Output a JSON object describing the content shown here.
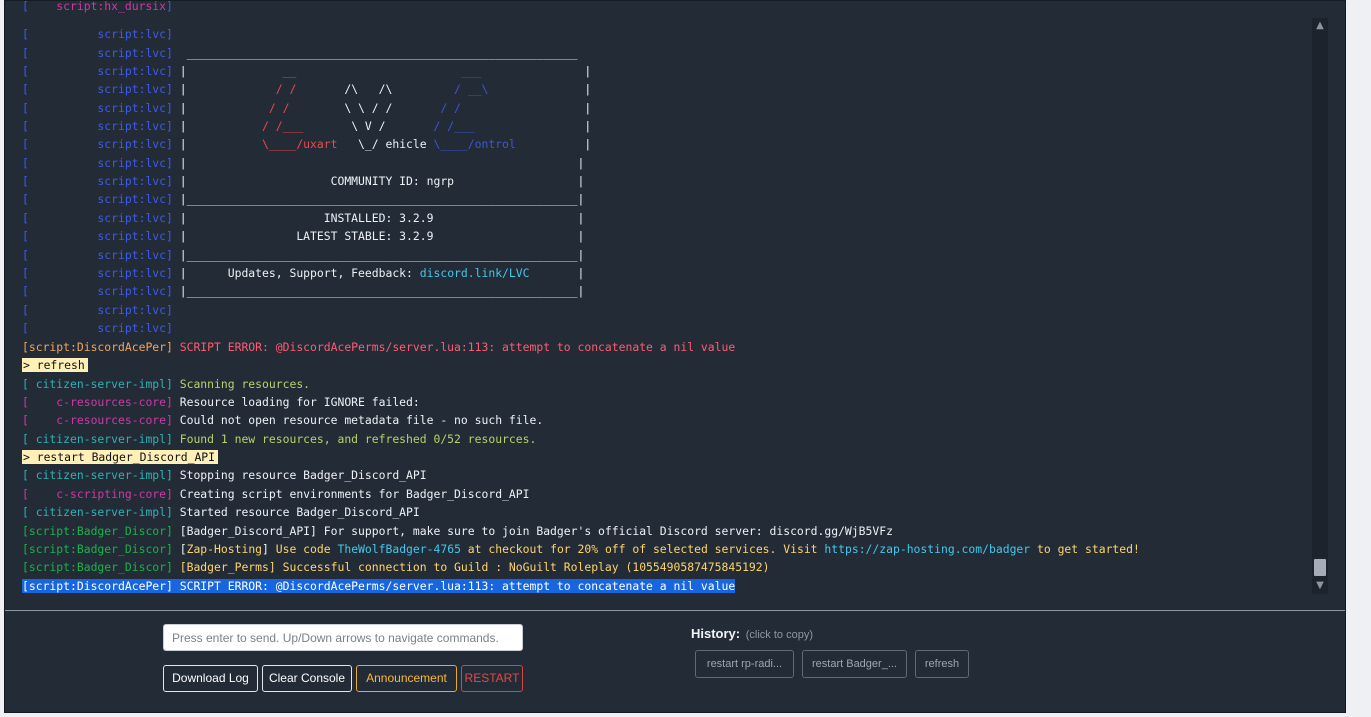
{
  "console": {
    "lines": [
      {
        "t": -4,
        "parts": [
          {
            "c": "c-blue",
            "v": "[    "
          },
          {
            "c": "c-res",
            "v": "script:hx_dursix"
          },
          {
            "c": "c-blue",
            "v": "]"
          }
        ]
      },
      {
        "t": 24,
        "parts": [
          {
            "c": "c-blue",
            "v": "[          script:lvc]"
          }
        ]
      },
      {
        "t": 43,
        "parts": [
          {
            "c": "c-blue",
            "v": "[          script:lvc]"
          },
          {
            "c": "c-wht",
            "v": "  _________________________________________________________"
          }
        ]
      },
      {
        "t": 61,
        "parts": [
          {
            "c": "c-blue",
            "v": "[          script:lvc]"
          },
          {
            "c": "c-wht",
            "v": " |"
          },
          {
            "c": "c-red",
            "v": "              __                        "
          },
          {
            "c": "c-sep",
            "v": "___"
          },
          {
            "c": "c-wht",
            "v": "               |"
          }
        ]
      },
      {
        "t": 79,
        "parts": [
          {
            "c": "c-blue",
            "v": "[          script:lvc]"
          },
          {
            "c": "c-wht",
            "v": " |"
          },
          {
            "c": "c-red",
            "v": "             / /"
          },
          {
            "c": "c-wht",
            "v": "       /\\   /\\       "
          },
          {
            "c": "c-sep",
            "v": "  / __\\"
          },
          {
            "c": "c-wht",
            "v": "              |"
          }
        ]
      },
      {
        "t": 98,
        "parts": [
          {
            "c": "c-blue",
            "v": "[          script:lvc]"
          },
          {
            "c": "c-wht",
            "v": " |"
          },
          {
            "c": "c-red",
            "v": "            / /"
          },
          {
            "c": "c-wht",
            "v": "        \\ \\ / /      "
          },
          {
            "c": "c-sep",
            "v": " / /"
          },
          {
            "c": "c-wht",
            "v": "                  |"
          }
        ]
      },
      {
        "t": 116,
        "parts": [
          {
            "c": "c-blue",
            "v": "[          script:lvc]"
          },
          {
            "c": "c-wht",
            "v": " |"
          },
          {
            "c": "c-red",
            "v": "           / /___"
          },
          {
            "c": "c-wht",
            "v": "       \\ V /       "
          },
          {
            "c": "c-sep",
            "v": "/ /___"
          },
          {
            "c": "c-wht",
            "v": "                |"
          }
        ]
      },
      {
        "t": 134,
        "parts": [
          {
            "c": "c-blue",
            "v": "[          script:lvc]"
          },
          {
            "c": "c-wht",
            "v": " |"
          },
          {
            "c": "c-red",
            "v": "           \\____/uxart"
          },
          {
            "c": "c-wht",
            "v": "   \\_/ ehicle "
          },
          {
            "c": "c-sep",
            "v": "\\____/ontrol"
          },
          {
            "c": "c-wht",
            "v": "          |"
          }
        ]
      },
      {
        "t": 153,
        "parts": [
          {
            "c": "c-blue",
            "v": "[          script:lvc]"
          },
          {
            "c": "c-wht",
            "v": " |                                                         |"
          }
        ]
      },
      {
        "t": 171,
        "parts": [
          {
            "c": "c-blue",
            "v": "[          script:lvc]"
          },
          {
            "c": "c-wht",
            "v": " |                     COMMUNITY ID: ngrp                  |"
          }
        ]
      },
      {
        "t": 189,
        "parts": [
          {
            "c": "c-blue",
            "v": "[          script:lvc]"
          },
          {
            "c": "c-wht",
            "v": " |_________________________________________________________|"
          }
        ]
      },
      {
        "t": 208,
        "parts": [
          {
            "c": "c-blue",
            "v": "[          script:lvc]"
          },
          {
            "c": "c-wht",
            "v": " |                    INSTALLED: 3.2.9                     |"
          }
        ]
      },
      {
        "t": 226,
        "parts": [
          {
            "c": "c-blue",
            "v": "[          script:lvc]"
          },
          {
            "c": "c-wht",
            "v": " |                LATEST STABLE: 3.2.9                     |"
          }
        ]
      },
      {
        "t": 245,
        "parts": [
          {
            "c": "c-blue",
            "v": "[          script:lvc]"
          },
          {
            "c": "c-wht",
            "v": " |_________________________________________________________|"
          }
        ]
      },
      {
        "t": 263,
        "parts": [
          {
            "c": "c-blue",
            "v": "[          script:lvc]"
          },
          {
            "c": "c-wht",
            "v": " |      Updates, Support, Feedback: "
          },
          {
            "c": "c-cyan",
            "v": "discord.link/LVC"
          },
          {
            "c": "c-wht",
            "v": "       |"
          }
        ]
      },
      {
        "t": 281,
        "parts": [
          {
            "c": "c-blue",
            "v": "[          script:lvc]"
          },
          {
            "c": "c-wht",
            "v": " |_________________________________________________________|"
          }
        ]
      },
      {
        "t": 300,
        "parts": [
          {
            "c": "c-blue",
            "v": "[          script:lvc]"
          }
        ]
      },
      {
        "t": 318,
        "parts": [
          {
            "c": "c-blue",
            "v": "[          script:lvc]"
          }
        ]
      },
      {
        "t": 337,
        "parts": [
          {
            "c": "c-disc",
            "v": "[script:DiscordAcePer]"
          },
          {
            "c": "c-err",
            "v": " SCRIPT ERROR: @DiscordAcePerms/server.lua:113: attempt to concatenate a nil value"
          }
        ]
      },
      {
        "t": 355,
        "parts": [
          {
            "c": "cmd",
            "v": "> refresh"
          }
        ]
      },
      {
        "t": 374,
        "parts": [
          {
            "c": "c-cit",
            "v": "[ citizen-server-impl]"
          },
          {
            "c": "c-ok",
            "v": " Scanning resources."
          }
        ]
      },
      {
        "t": 392,
        "parts": [
          {
            "c": "c-res",
            "v": "[    c-resources-core]"
          },
          {
            "c": "c-wht",
            "v": " Resource loading for IGNORE failed:"
          }
        ]
      },
      {
        "t": 410,
        "parts": [
          {
            "c": "c-res",
            "v": "[    c-resources-core]"
          },
          {
            "c": "c-wht",
            "v": " Could not open resource metadata file - no such file."
          }
        ]
      },
      {
        "t": 429,
        "parts": [
          {
            "c": "c-cit",
            "v": "[ citizen-server-impl]"
          },
          {
            "c": "c-ok",
            "v": " Found 1 new resources, and refreshed 0/52 resources."
          }
        ]
      },
      {
        "t": 447,
        "parts": [
          {
            "c": "cmd",
            "v": "> restart Badger_Discord_API"
          }
        ]
      },
      {
        "t": 465,
        "parts": [
          {
            "c": "c-cit",
            "v": "[ citizen-server-impl]"
          },
          {
            "c": "c-wht",
            "v": " Stopping resource Badger_Discord_API"
          }
        ]
      },
      {
        "t": 484,
        "parts": [
          {
            "c": "c-res",
            "v": "[    c-scripting-core]"
          },
          {
            "c": "c-wht",
            "v": " Creating script environments for Badger_Discord_API"
          }
        ]
      },
      {
        "t": 502,
        "parts": [
          {
            "c": "c-cit",
            "v": "[ citizen-server-impl]"
          },
          {
            "c": "c-wht",
            "v": " Started resource Badger_Discord_API"
          }
        ]
      },
      {
        "t": 521,
        "parts": [
          {
            "c": "c-badg",
            "v": "[script:Badger_Discor]"
          },
          {
            "c": "c-wht",
            "v": " [Badger_Discord_API] For support, make sure to join Badger's official Discord server: discord.gg/WjB5VFz"
          }
        ]
      },
      {
        "t": 539,
        "parts": [
          {
            "c": "c-badg",
            "v": "[script:Badger_Discor]"
          },
          {
            "c": "c-wht",
            "v": " ["
          },
          {
            "c": "c-yel",
            "v": "Zap-Hosting"
          },
          {
            "c": "c-wht",
            "v": "] "
          },
          {
            "c": "c-yel",
            "v": "Use code "
          },
          {
            "c": "c-cyan",
            "v": "TheWolfBadger-4765"
          },
          {
            "c": "c-yel",
            "v": " at checkout for 20% off of selected services. Visit "
          },
          {
            "c": "c-cyan",
            "v": "https://zap-hosting.com/badger"
          },
          {
            "c": "c-yel",
            "v": " to get started!"
          }
        ]
      },
      {
        "t": 557,
        "parts": [
          {
            "c": "c-badg",
            "v": "[script:Badger_Discor]"
          },
          {
            "c": "c-yel",
            "v": " [Badger_Perms] Successful connection to Guild : NoGuilt Roleplay (1055490587475845192)"
          }
        ]
      },
      {
        "t": 576,
        "parts": [
          {
            "c": "sel",
            "v": "[script:DiscordAcePer] SCRIPT ERROR: @DiscordAcePerms/server.lua:113: attempt to concatenate a nil value"
          }
        ]
      }
    ]
  },
  "scrollbar": {
    "up_icon": "▲",
    "down_icon": "▼"
  },
  "input": {
    "placeholder": "Press enter to send. Up/Down arrows to navigate commands.",
    "value": ""
  },
  "buttons": {
    "download_log": "Download Log",
    "clear_console": "Clear Console",
    "announcement": "Announcement",
    "restart": "RESTART"
  },
  "history": {
    "title": "History:",
    "hint": "(click to copy)",
    "items": [
      "restart rp-radi...",
      "restart Badger_...",
      "refresh"
    ]
  },
  "colors": {
    "panel": "#222b36",
    "accent_warn": "#ffb830",
    "accent_danger": "#e04a4a",
    "selection": "#1766e0"
  }
}
